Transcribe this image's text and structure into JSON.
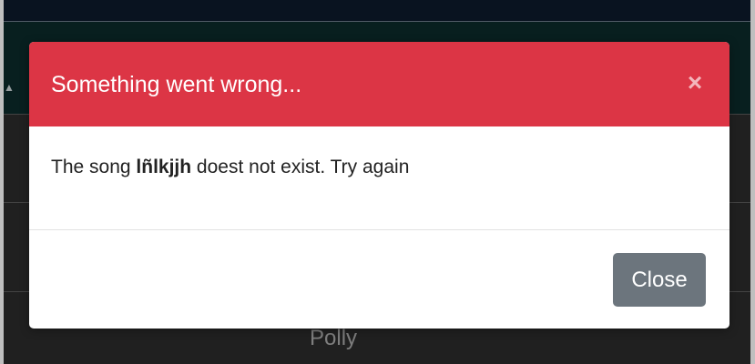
{
  "background": {
    "sort_icon": "chevron-up-icon",
    "visible_cell_text": "Polly"
  },
  "modal": {
    "title": "Something went wrong...",
    "close_icon": "close-icon",
    "close_glyph": "×",
    "body": {
      "prefix": "The song ",
      "song_name": "lñlkjjh",
      "suffix": " doest not exist. Try again"
    },
    "footer": {
      "close_label": "Close"
    },
    "colors": {
      "header": "#dc3545",
      "close_button": "#6c757d"
    }
  }
}
